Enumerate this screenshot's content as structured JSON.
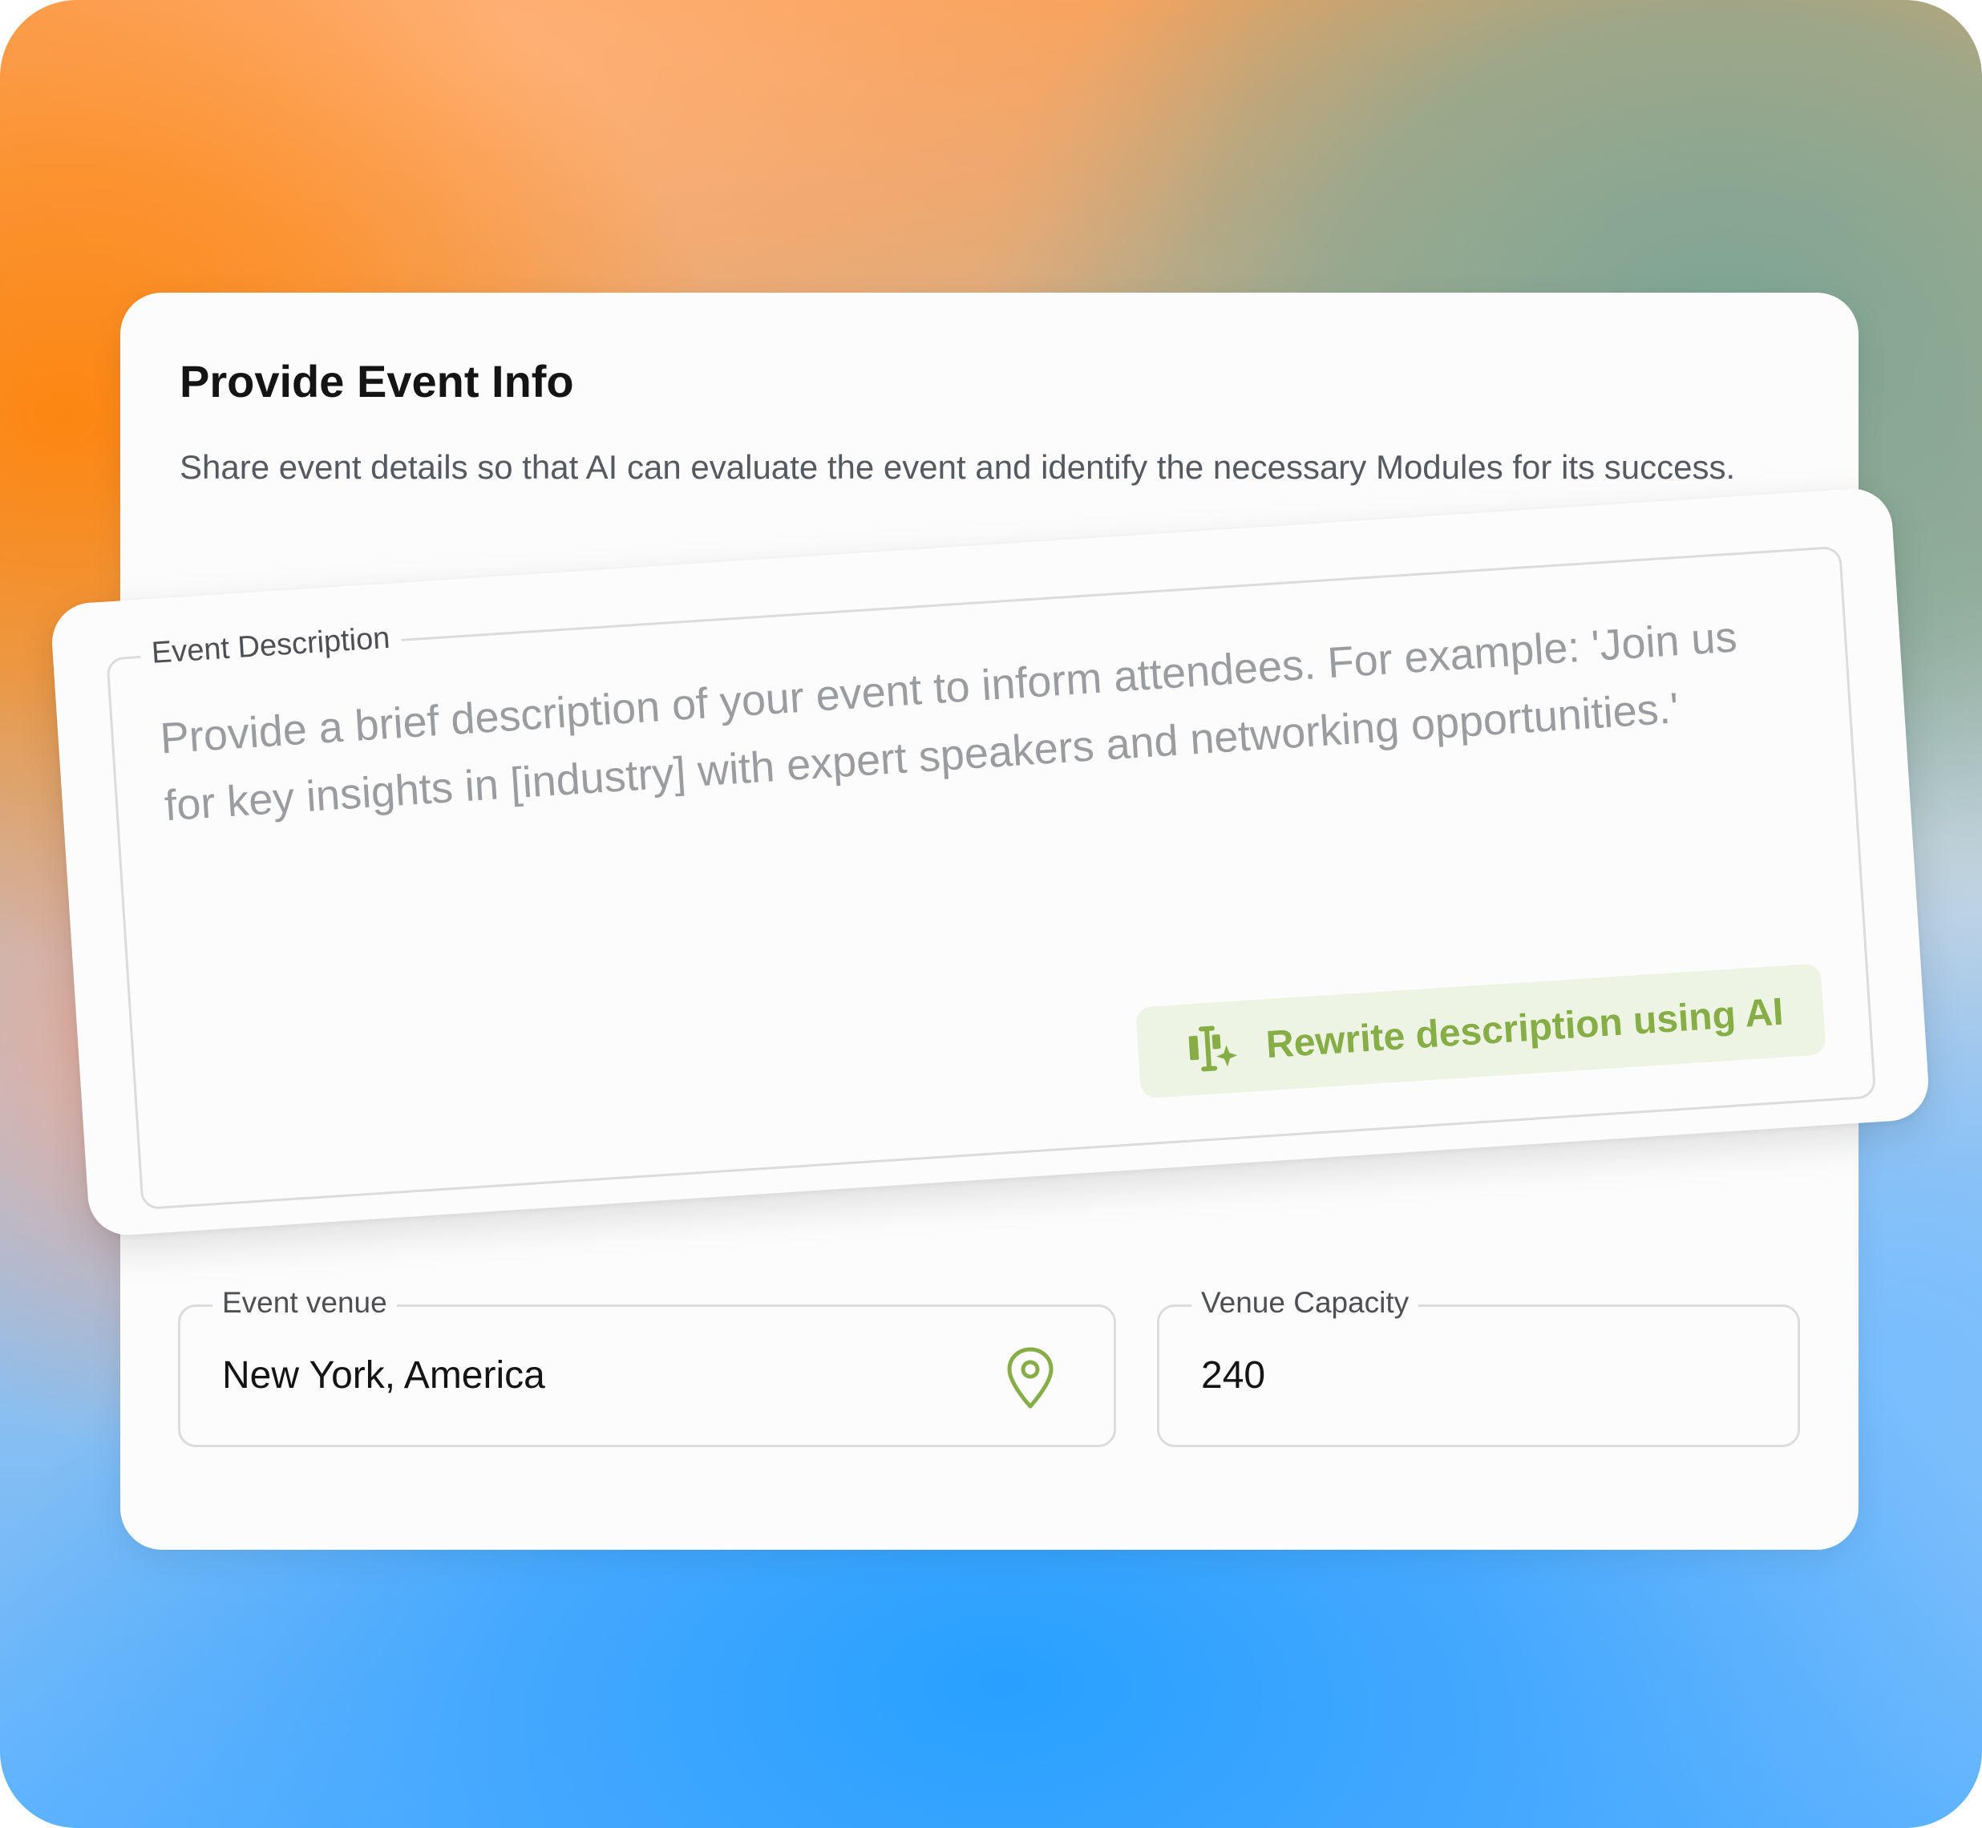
{
  "form": {
    "title": "Provide Event Info",
    "subtitle": "Share event details so that AI can evaluate the event and identify the necessary Modules for its success.",
    "description": {
      "label": "Event Description",
      "placeholder": "Provide a brief description of your event to inform attendees. For example: 'Join us for key insights in [industry] with expert speakers and networking opportunities.'",
      "ai_button_label": "Rewrite description using AI",
      "ai_icon": "text-cursor-sparkle-icon"
    },
    "venue": {
      "label": "Event venue",
      "value": "New York, America",
      "icon": "location-pin-icon"
    },
    "capacity": {
      "label": "Venue Capacity",
      "value": "240"
    }
  },
  "colors": {
    "accent": "#86AD46",
    "accent_bg": "#EEF4E4",
    "title": "#141414",
    "muted_text": "#555A60",
    "placeholder": "#9A9CA0",
    "border": "#DCDCDC"
  }
}
